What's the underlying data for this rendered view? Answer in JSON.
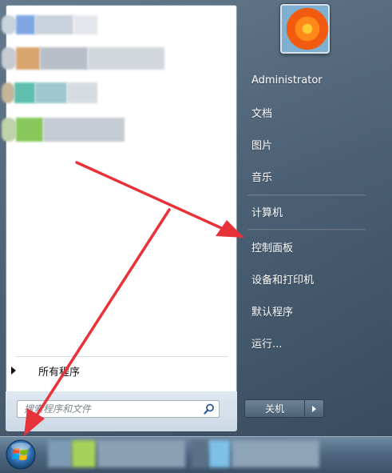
{
  "user": {
    "name": "Administrator"
  },
  "right_menu": {
    "documents": "文档",
    "pictures": "图片",
    "music": "音乐",
    "computer": "计算机",
    "control_panel": "控制面板",
    "devices_printers": "设备和打印机",
    "default_programs": "默认程序",
    "run": "运行..."
  },
  "left_panel": {
    "all_programs": "所有程序",
    "search_placeholder": "搜索程序和文件"
  },
  "shutdown": {
    "label": "关机"
  },
  "colors": {
    "annotation_arrow": "#e8323a",
    "menu_right_bg": "#4a6076",
    "taskbar": "#4e677f"
  },
  "icons": [
    "user-picture",
    "search-icon",
    "windows-start-orb",
    "shutdown-arrow-icon",
    "all-programs-arrow-icon"
  ]
}
